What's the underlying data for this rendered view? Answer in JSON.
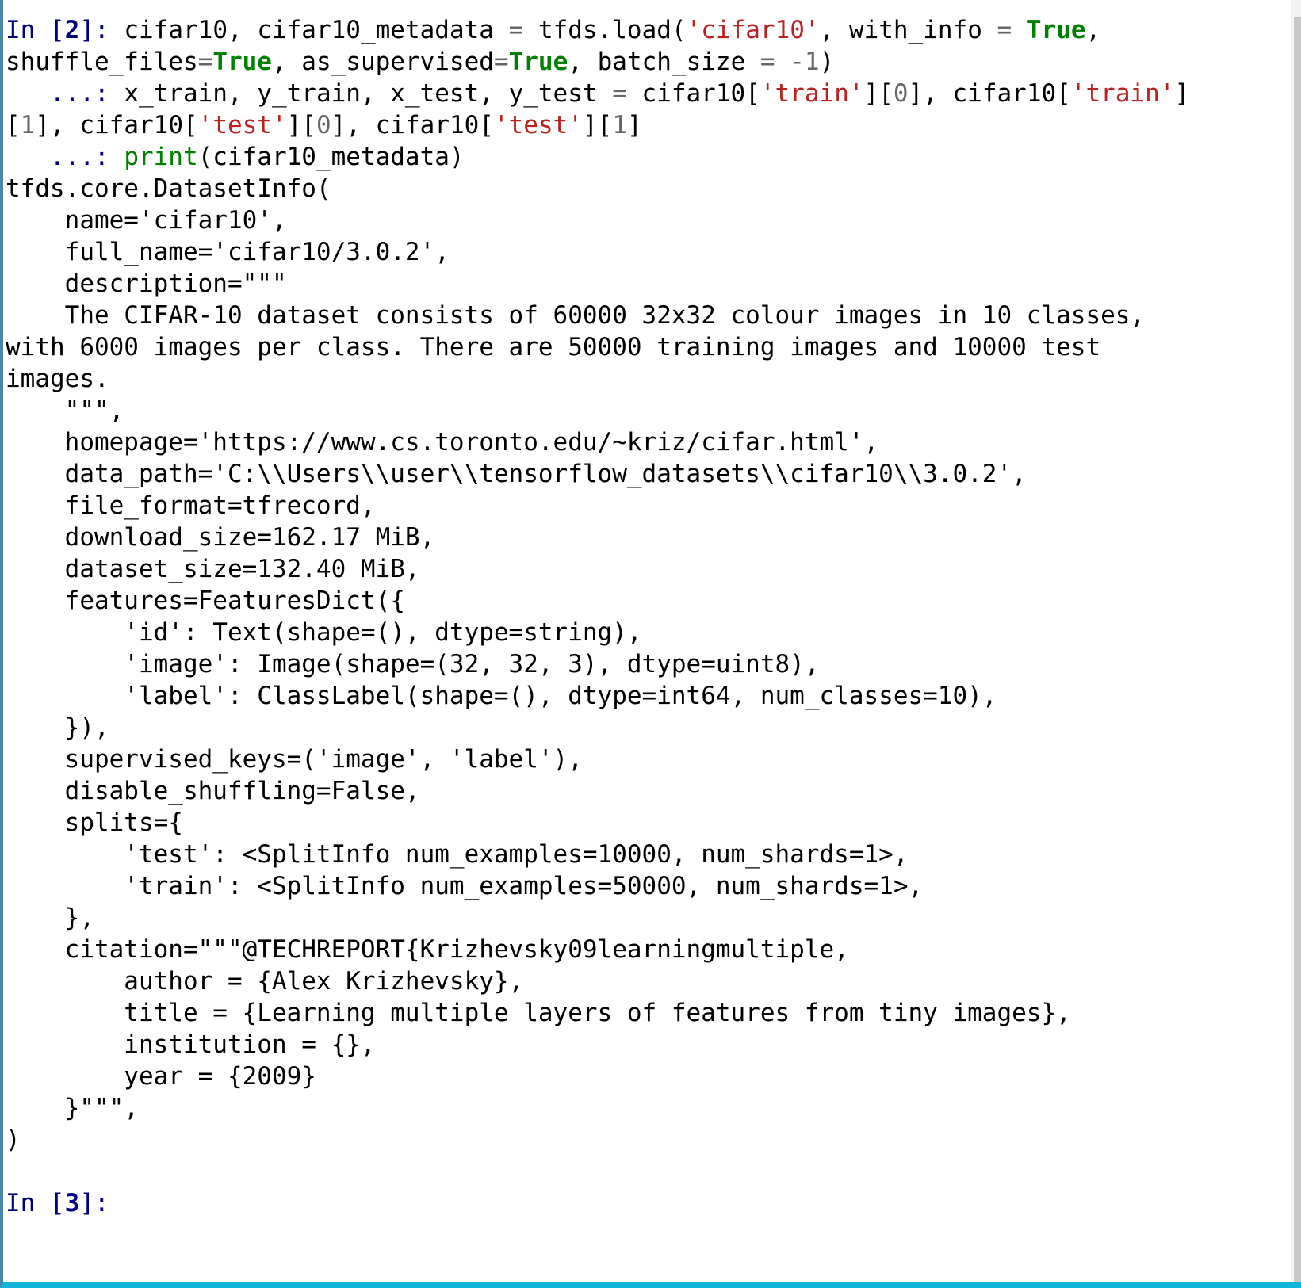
{
  "app": {
    "name": "jupyter-qtconsole",
    "kernel": "python",
    "colors": {
      "left_border": "#4a86a8",
      "bottom_border": "#12b5d8",
      "scrollbar_track": "#f3f3f3",
      "scrollbar_thumb": "#c8c8c8",
      "background": "#ffffff",
      "prompt": "#000080",
      "string": "#ba2121",
      "keyword": "#008000",
      "builtin": "#008000",
      "operator": "#666666",
      "number": "#666666",
      "text": "#000000"
    }
  },
  "prompts": {
    "input_2": "In [2]:",
    "input_3": "In [3]:",
    "continuation": "...:"
  },
  "cells": [
    {
      "type": "input",
      "prompt": "In [2]:",
      "lines": [
        [
          {
            "t": "In ",
            "c": "prompt"
          },
          {
            "t": "[",
            "c": "prompt"
          },
          {
            "t": "2",
            "c": "promptnum"
          },
          {
            "t": "]: ",
            "c": "prompt"
          },
          {
            "t": "cifar10, cifar10_metadata ",
            "c": "plain"
          },
          {
            "t": "=",
            "c": "op"
          },
          {
            "t": " tfds.load(",
            "c": "plain"
          },
          {
            "t": "'cifar10'",
            "c": "str"
          },
          {
            "t": ", with_info ",
            "c": "plain"
          },
          {
            "t": "=",
            "c": "op"
          },
          {
            "t": " ",
            "c": "plain"
          },
          {
            "t": "True",
            "c": "kw"
          },
          {
            "t": ",",
            "c": "plain"
          }
        ],
        [
          {
            "t": "shuffle_files",
            "c": "plain"
          },
          {
            "t": "=",
            "c": "op"
          },
          {
            "t": "True",
            "c": "kw"
          },
          {
            "t": ", as_supervised",
            "c": "plain"
          },
          {
            "t": "=",
            "c": "op"
          },
          {
            "t": "True",
            "c": "kw"
          },
          {
            "t": ", batch_size ",
            "c": "plain"
          },
          {
            "t": "=",
            "c": "op"
          },
          {
            "t": " ",
            "c": "plain"
          },
          {
            "t": "-",
            "c": "op"
          },
          {
            "t": "1",
            "c": "num"
          },
          {
            "t": ")",
            "c": "plain"
          }
        ],
        [
          {
            "t": "   ...: ",
            "c": "prompt"
          },
          {
            "t": "x_train, y_train, x_test, y_test ",
            "c": "plain"
          },
          {
            "t": "=",
            "c": "op"
          },
          {
            "t": " cifar10[",
            "c": "plain"
          },
          {
            "t": "'train'",
            "c": "str"
          },
          {
            "t": "][",
            "c": "plain"
          },
          {
            "t": "0",
            "c": "num"
          },
          {
            "t": "], cifar10[",
            "c": "plain"
          },
          {
            "t": "'train'",
            "c": "str"
          },
          {
            "t": "]",
            "c": "plain"
          }
        ],
        [
          {
            "t": "[",
            "c": "plain"
          },
          {
            "t": "1",
            "c": "num"
          },
          {
            "t": "], cifar10[",
            "c": "plain"
          },
          {
            "t": "'test'",
            "c": "str"
          },
          {
            "t": "][",
            "c": "plain"
          },
          {
            "t": "0",
            "c": "num"
          },
          {
            "t": "], cifar10[",
            "c": "plain"
          },
          {
            "t": "'test'",
            "c": "str"
          },
          {
            "t": "][",
            "c": "plain"
          },
          {
            "t": "1",
            "c": "num"
          },
          {
            "t": "]",
            "c": "plain"
          }
        ],
        [
          {
            "t": "   ...: ",
            "c": "prompt"
          },
          {
            "t": "print",
            "c": "builtin"
          },
          {
            "t": "(cifar10_metadata)",
            "c": "plain"
          }
        ]
      ]
    },
    {
      "type": "output",
      "lines": [
        [
          {
            "t": "tfds.core.DatasetInfo(",
            "c": "plain"
          }
        ],
        [
          {
            "t": "    name='cifar10',",
            "c": "plain"
          }
        ],
        [
          {
            "t": "    full_name='cifar10/3.0.2',",
            "c": "plain"
          }
        ],
        [
          {
            "t": "    description=\"\"\"",
            "c": "plain"
          }
        ],
        [
          {
            "t": "    The CIFAR-10 dataset consists of 60000 32x32 colour images in 10 classes,",
            "c": "plain"
          }
        ],
        [
          {
            "t": "with 6000 images per class. There are 50000 training images and 10000 test",
            "c": "plain"
          }
        ],
        [
          {
            "t": "images.",
            "c": "plain"
          }
        ],
        [
          {
            "t": "    \"\"\",",
            "c": "plain"
          }
        ],
        [
          {
            "t": "    homepage='https://www.cs.toronto.edu/~kriz/cifar.html',",
            "c": "plain"
          }
        ],
        [
          {
            "t": "    data_path='C:\\\\Users\\\\user\\\\tensorflow_datasets\\\\cifar10\\\\3.0.2',",
            "c": "plain"
          }
        ],
        [
          {
            "t": "    file_format=tfrecord,",
            "c": "plain"
          }
        ],
        [
          {
            "t": "    download_size=162.17 MiB,",
            "c": "plain"
          }
        ],
        [
          {
            "t": "    dataset_size=132.40 MiB,",
            "c": "plain"
          }
        ],
        [
          {
            "t": "    features=FeaturesDict({",
            "c": "plain"
          }
        ],
        [
          {
            "t": "        'id': Text(shape=(), dtype=string),",
            "c": "plain"
          }
        ],
        [
          {
            "t": "        'image': Image(shape=(32, 32, 3), dtype=uint8),",
            "c": "plain"
          }
        ],
        [
          {
            "t": "        'label': ClassLabel(shape=(), dtype=int64, num_classes=10),",
            "c": "plain"
          }
        ],
        [
          {
            "t": "    }),",
            "c": "plain"
          }
        ],
        [
          {
            "t": "    supervised_keys=('image', 'label'),",
            "c": "plain"
          }
        ],
        [
          {
            "t": "    disable_shuffling=False,",
            "c": "plain"
          }
        ],
        [
          {
            "t": "    splits={",
            "c": "plain"
          }
        ],
        [
          {
            "t": "        'test': <SplitInfo num_examples=10000, num_shards=1>,",
            "c": "plain"
          }
        ],
        [
          {
            "t": "        'train': <SplitInfo num_examples=50000, num_shards=1>,",
            "c": "plain"
          }
        ],
        [
          {
            "t": "    },",
            "c": "plain"
          }
        ],
        [
          {
            "t": "    citation=\"\"\"@TECHREPORT{Krizhevsky09learningmultiple,",
            "c": "plain"
          }
        ],
        [
          {
            "t": "        author = {Alex Krizhevsky},",
            "c": "plain"
          }
        ],
        [
          {
            "t": "        title = {Learning multiple layers of features from tiny images},",
            "c": "plain"
          }
        ],
        [
          {
            "t": "        institution = {},",
            "c": "plain"
          }
        ],
        [
          {
            "t": "        year = {2009}",
            "c": "plain"
          }
        ],
        [
          {
            "t": "    }\"\"\",",
            "c": "plain"
          }
        ],
        [
          {
            "t": ")",
            "c": "plain"
          }
        ],
        [
          {
            "t": "",
            "c": "plain"
          }
        ]
      ]
    },
    {
      "type": "input",
      "prompt": "In [3]:",
      "lines": [
        [
          {
            "t": "In ",
            "c": "prompt"
          },
          {
            "t": "[",
            "c": "prompt"
          },
          {
            "t": "3",
            "c": "promptnum"
          },
          {
            "t": "]:",
            "c": "prompt"
          }
        ]
      ]
    }
  ],
  "dataset_info": {
    "name": "cifar10",
    "full_name": "cifar10/3.0.2",
    "description": "The CIFAR-10 dataset consists of 60000 32x32 colour images in 10 classes, with 6000 images per class. There are 50000 training images and 10000 test images.",
    "homepage": "https://www.cs.toronto.edu/~kriz/cifar.html",
    "data_path": "C:\\Users\\user\\tensorflow_datasets\\cifar10\\3.0.2",
    "file_format": "tfrecord",
    "download_size": "162.17 MiB",
    "dataset_size": "132.40 MiB",
    "num_classes": 10,
    "image_shape": "(32, 32, 3)",
    "image_dtype": "uint8",
    "label_dtype": "int64",
    "id_dtype": "string",
    "supervised_keys": "('image', 'label')",
    "disable_shuffling": "False",
    "splits": [
      {
        "name": "test",
        "num_examples": 10000,
        "num_shards": 1
      },
      {
        "name": "train",
        "num_examples": 50000,
        "num_shards": 1
      }
    ],
    "citation": {
      "key": "@TECHREPORT{Krizhevsky09learningmultiple",
      "author": "Alex Krizhevsky",
      "title": "Learning multiple layers of features from tiny images",
      "institution": "",
      "year": "2009"
    }
  }
}
